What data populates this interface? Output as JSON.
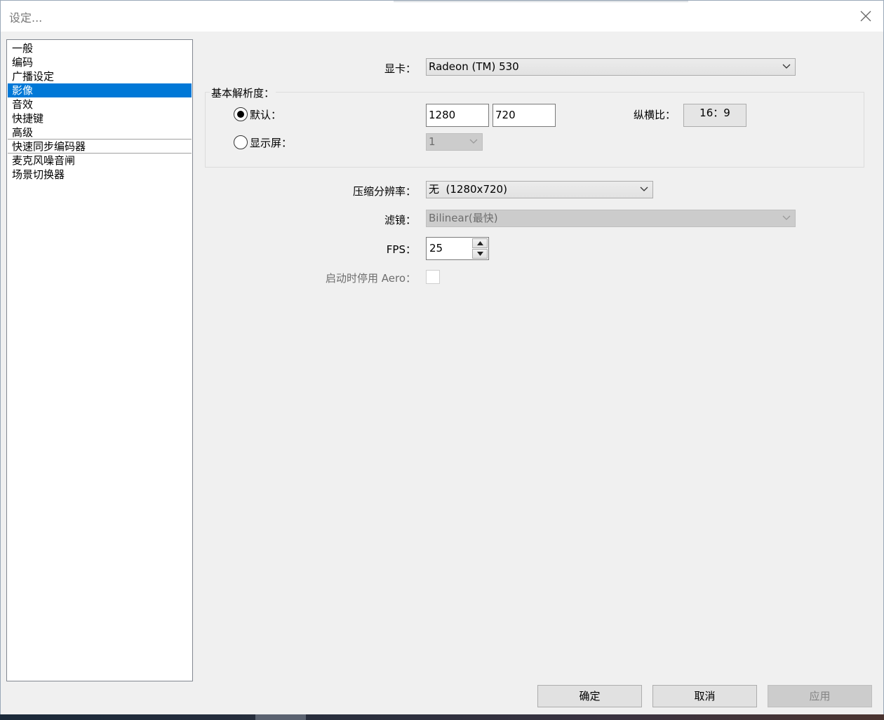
{
  "window": {
    "title": "设定..."
  },
  "sidebar": {
    "items": [
      {
        "label": "一般"
      },
      {
        "label": "编码"
      },
      {
        "label": "广播设定"
      },
      {
        "label": "影像"
      },
      {
        "label": "音效"
      },
      {
        "label": "快捷键"
      },
      {
        "label": "高级"
      },
      {
        "label": "快速同步编码器"
      },
      {
        "label": "麦克风噪音闸"
      },
      {
        "label": "场景切换器"
      }
    ],
    "selected": "影像"
  },
  "video": {
    "gpu_label": "显卡：",
    "gpu_value": "Radeon (TM) 530",
    "base_res": {
      "legend": "基本解析度：",
      "default_label": "默认：",
      "width": "1280",
      "height": "720",
      "aspect_label": "纵横比：",
      "aspect_value": "16：9",
      "monitor_label": "显示屏：",
      "monitor_value": "1"
    },
    "downscale_label": "压缩分辨率：",
    "downscale_value": "无  (1280x720)",
    "filter_label": "滤镜：",
    "filter_value": "Bilinear(最快)",
    "fps_label": "FPS：",
    "fps_value": "25",
    "aero_label": "启动时停用 Aero："
  },
  "buttons": {
    "ok": "确定",
    "cancel": "取消",
    "apply": "应用"
  }
}
